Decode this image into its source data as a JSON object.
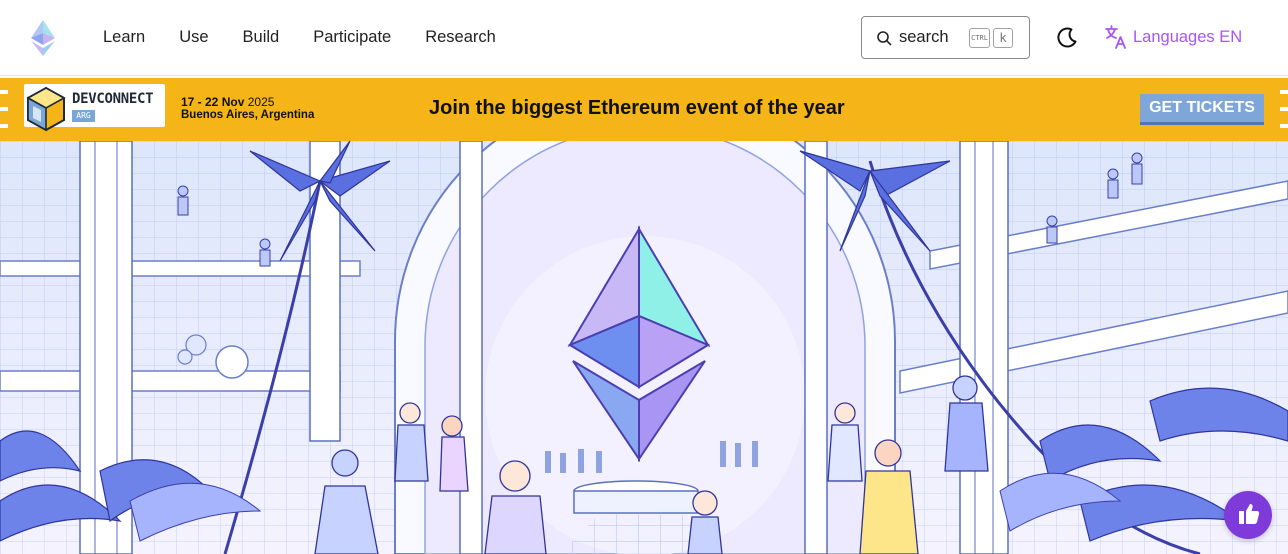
{
  "header": {
    "logo_icon": "ethereum-logo",
    "nav": [
      "Learn",
      "Use",
      "Build",
      "Participate",
      "Research"
    ],
    "search": {
      "label": "search",
      "shortcut_ctrl": "CTRL",
      "shortcut_key": "k"
    },
    "theme_icon": "moon-icon",
    "language": {
      "label": "Languages EN",
      "icon": "translate-icon"
    }
  },
  "banner": {
    "brand_word": "DEVCONNECT",
    "brand_tag": "ARG",
    "dates": "17 - 22 Nov",
    "year": "2025",
    "city": "Buenos Aires, Argentina",
    "headline": "Join the biggest Ethereum event of the year",
    "cta": "GET TICKETS",
    "colors": {
      "background": "#f5b418",
      "cta": "#7ea6d8"
    }
  },
  "hero": {
    "image": "ethereum-community-illustration"
  },
  "chat": {
    "icon": "feedback-icon",
    "color": "#7e3bd9"
  }
}
